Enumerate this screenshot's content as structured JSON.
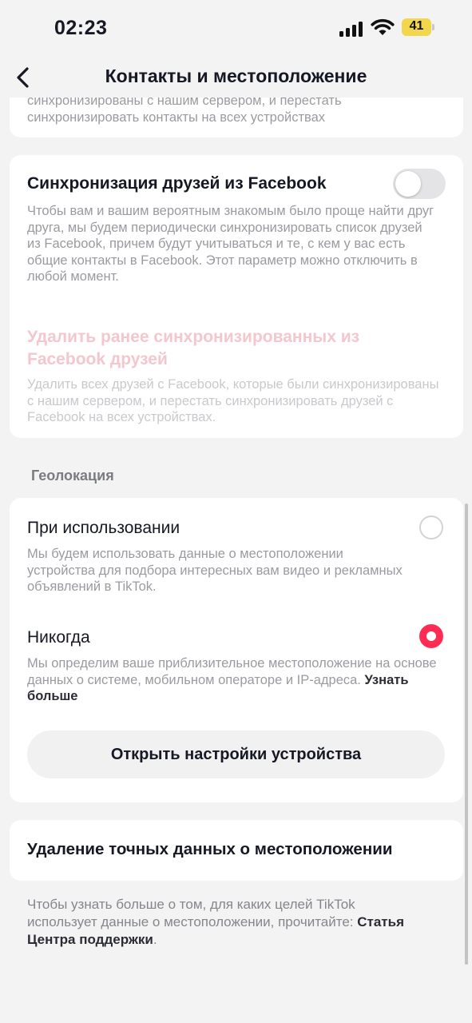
{
  "status_bar": {
    "time": "02:23",
    "battery": "41"
  },
  "header": {
    "title": "Контакты и местоположение"
  },
  "contacts_card": {
    "description": "синхронизированы с нашим сервером, и перестать синхронизировать контакты на всех устройствах"
  },
  "facebook_card": {
    "title": "Синхронизация друзей из Facebook",
    "description": "Чтобы вам и вашим вероятным знакомым было проще найти друг друга, мы будем периодически синхронизировать список друзей из Facebook, причем будут учитываться и те, с кем у вас есть общие контакты в Facebook. Этот параметр можно отключить в любой момент.",
    "toggle_on": false,
    "delete_title": "Удалить ранее синхронизированных из Facebook друзей",
    "delete_description": "Удалить всех друзей с Facebook, которые были синхронизированы с нашим сервером, и перестать синхронизировать друзей с Facebook на всех устройствах."
  },
  "location_section": {
    "label": "Геолокация",
    "option_while_using": {
      "title": "При использовании",
      "description": "Мы будем использовать данные о местоположении устройства для подбора интересных вам видео и рекламных объявлений в TikTok.",
      "selected": false
    },
    "option_never": {
      "title": "Никогда",
      "description": "Мы определим ваше приблизительное местоположение на основе данных о системе, мобильном операторе и IP-адреса.",
      "learn_more": "Узнать больше",
      "selected": true
    },
    "open_settings_button": "Открыть настройки устройства"
  },
  "delete_location": {
    "title": "Удаление точных данных о местоположении"
  },
  "footer": {
    "text": "Чтобы узнать больше о том, для каких целей TikTok использует данные о местоположении, прочитайте:",
    "link": "Статья Центра поддержки",
    "suffix": "."
  },
  "colors": {
    "accent": "#fe2c55",
    "battery": "#f2d74c",
    "background": "#f3f3f4"
  }
}
